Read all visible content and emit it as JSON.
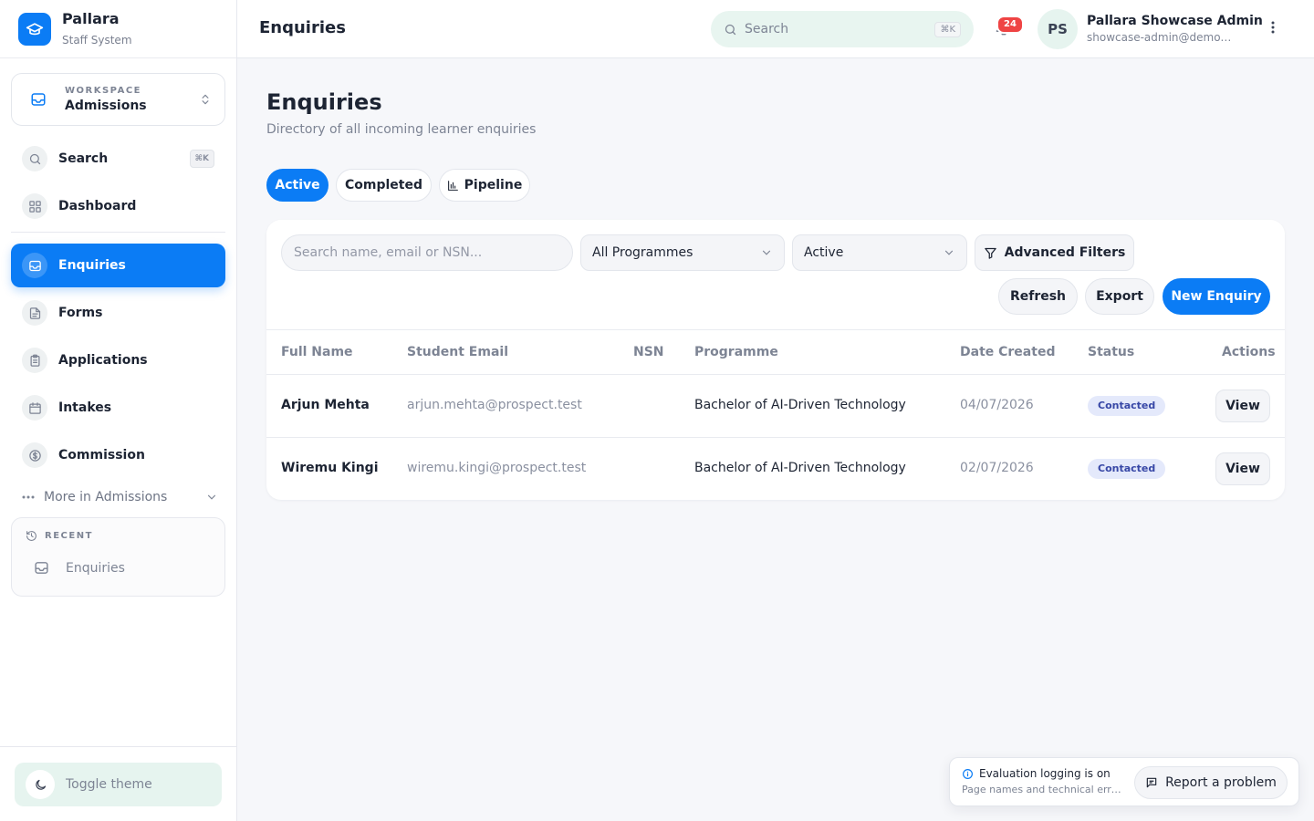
{
  "brand": {
    "name": "Pallara",
    "subtitle": "Staff System"
  },
  "workspace": {
    "label": "WORKSPACE",
    "name": "Admissions"
  },
  "sidebar": {
    "items": [
      {
        "label": "Search",
        "icon": "search-icon",
        "shortcut": "⌘K"
      },
      {
        "label": "Dashboard",
        "icon": "dashboard-icon"
      },
      {
        "label": "Enquiries",
        "icon": "inbox-icon",
        "active": true
      },
      {
        "label": "Forms",
        "icon": "document-icon"
      },
      {
        "label": "Applications",
        "icon": "clipboard-icon"
      },
      {
        "label": "Intakes",
        "icon": "calendar-icon"
      },
      {
        "label": "Commission",
        "icon": "dollar-icon"
      }
    ],
    "more_label": "More in Admissions",
    "recent": {
      "label": "RECENT",
      "items": [
        {
          "label": "Enquiries",
          "icon": "inbox-icon"
        }
      ]
    },
    "toggle_theme": "Toggle theme"
  },
  "header": {
    "title": "Enquiries",
    "search_placeholder": "Search",
    "search_shortcut": "⌘K",
    "notification_count": "24",
    "user": {
      "initials": "PS",
      "name": "Pallara Showcase Admin",
      "email": "showcase-admin@demo.pallara.test"
    }
  },
  "page": {
    "title": "Enquiries",
    "subtitle": "Directory of all incoming learner enquiries",
    "tabs": [
      {
        "label": "Active",
        "active": true
      },
      {
        "label": "Completed"
      },
      {
        "label": "Pipeline",
        "icon": "bar-chart-icon"
      }
    ]
  },
  "filters": {
    "search_placeholder": "Search name, email or NSN...",
    "programme": "All Programmes",
    "status": "Active",
    "advanced": "Advanced Filters",
    "refresh": "Refresh",
    "export": "Export",
    "new_enquiry": "New Enquiry"
  },
  "table": {
    "columns": [
      "Full Name",
      "Student Email",
      "NSN",
      "Programme",
      "Date Created",
      "Status",
      "Actions"
    ],
    "rows": [
      {
        "name": "Arjun Mehta",
        "email": "arjun.mehta@prospect.test",
        "nsn": "",
        "programme": "Bachelor of AI-Driven Technology",
        "date": "04/07/2026",
        "status": "Contacted",
        "action": "View"
      },
      {
        "name": "Wiremu Kingi",
        "email": "wiremu.kingi@prospect.test",
        "nsn": "",
        "programme": "Bachelor of AI-Driven Technology",
        "date": "02/07/2026",
        "status": "Contacted",
        "action": "View"
      }
    ]
  },
  "evaluation": {
    "title": "Evaluation logging is on",
    "subtitle": "Page names and technical errors are recorded",
    "report": "Report a problem"
  },
  "colors": {
    "primary": "#0b7cf5",
    "badge_bg": "#e4e9fb",
    "badge_text": "#3747a6",
    "notification": "#ef4444",
    "mint": "#e6f4ef"
  }
}
